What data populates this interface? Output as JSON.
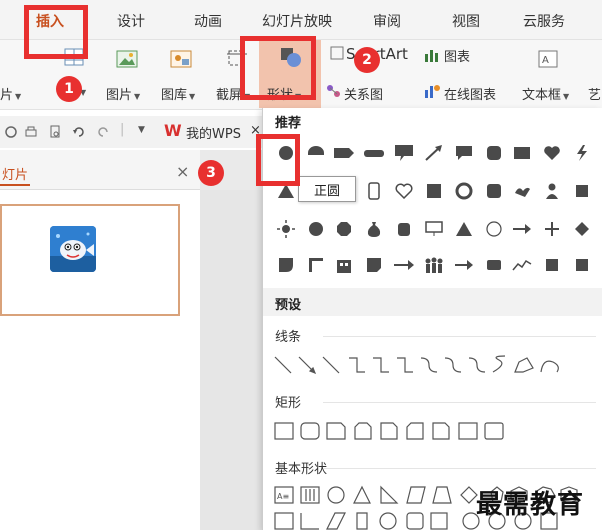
{
  "menu": {
    "tabs": [
      "插入",
      "设计",
      "动画",
      "幻灯片放映",
      "审阅",
      "视图",
      "云服务"
    ],
    "active": "插入"
  },
  "ribbon": {
    "partial_left": "片",
    "picture": "图片",
    "gallery": "图库",
    "screenshot": "截屏",
    "shapes": "形状",
    "smartart_prefix": "S",
    "smartart_suffix": "rtArt",
    "chart": "图表",
    "relation": "关系图",
    "online_chart": "在线图表",
    "textbox": "文本框",
    "partial_right": "艺"
  },
  "quick_access": {
    "wps_label": "我的WPS"
  },
  "panel": {
    "title": "灯片",
    "close": "×"
  },
  "shapes_menu": {
    "section_recommend": "推荐",
    "section_preset": "预设",
    "lines": "线条",
    "rectangles": "矩形",
    "basic_shapes": "基本形状",
    "tooltip": "正圆"
  },
  "badges": [
    "1",
    "2",
    "3"
  ],
  "colors": {
    "highlight": "#e8302f",
    "active_tab": "#c8501f",
    "shape_fill": "#4a4a4a"
  },
  "watermark": "最需教育"
}
